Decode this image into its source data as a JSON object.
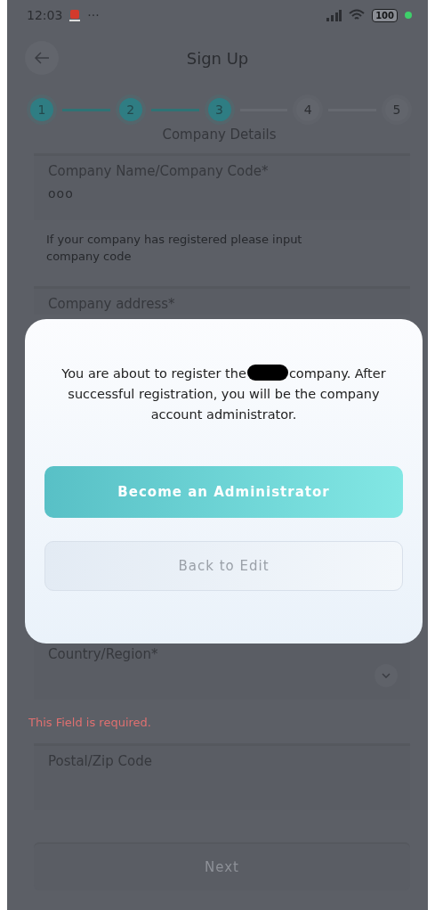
{
  "status_bar": {
    "time": "12:03",
    "more": "···",
    "battery": "100"
  },
  "header": {
    "title": "Sign Up"
  },
  "steps": [
    {
      "number": "1",
      "done": true
    },
    {
      "number": "2",
      "done": true
    },
    {
      "number": "3",
      "done": true
    },
    {
      "number": "4",
      "done": false
    },
    {
      "number": "5",
      "done": false
    }
  ],
  "step_title": "Company Details",
  "fields": [
    {
      "kind": "text",
      "label": "Company Name/Company Code*",
      "value": "ooo",
      "help": "If your company has registered please input company code"
    },
    {
      "kind": "partial",
      "label": "Company address*"
    },
    {
      "kind": "select",
      "label": "Country/Region*",
      "error": "This Field is required."
    },
    {
      "kind": "text",
      "label": "Postal/Zip Code"
    }
  ],
  "next_button": {
    "label": "Next",
    "disabled": true
  },
  "dialog": {
    "message_before": "You are about to register the",
    "message_after": "company. After successful registration, you will be the company account administrator.",
    "primary_button": "Become an Administrator",
    "secondary_button": "Back to Edit"
  }
}
